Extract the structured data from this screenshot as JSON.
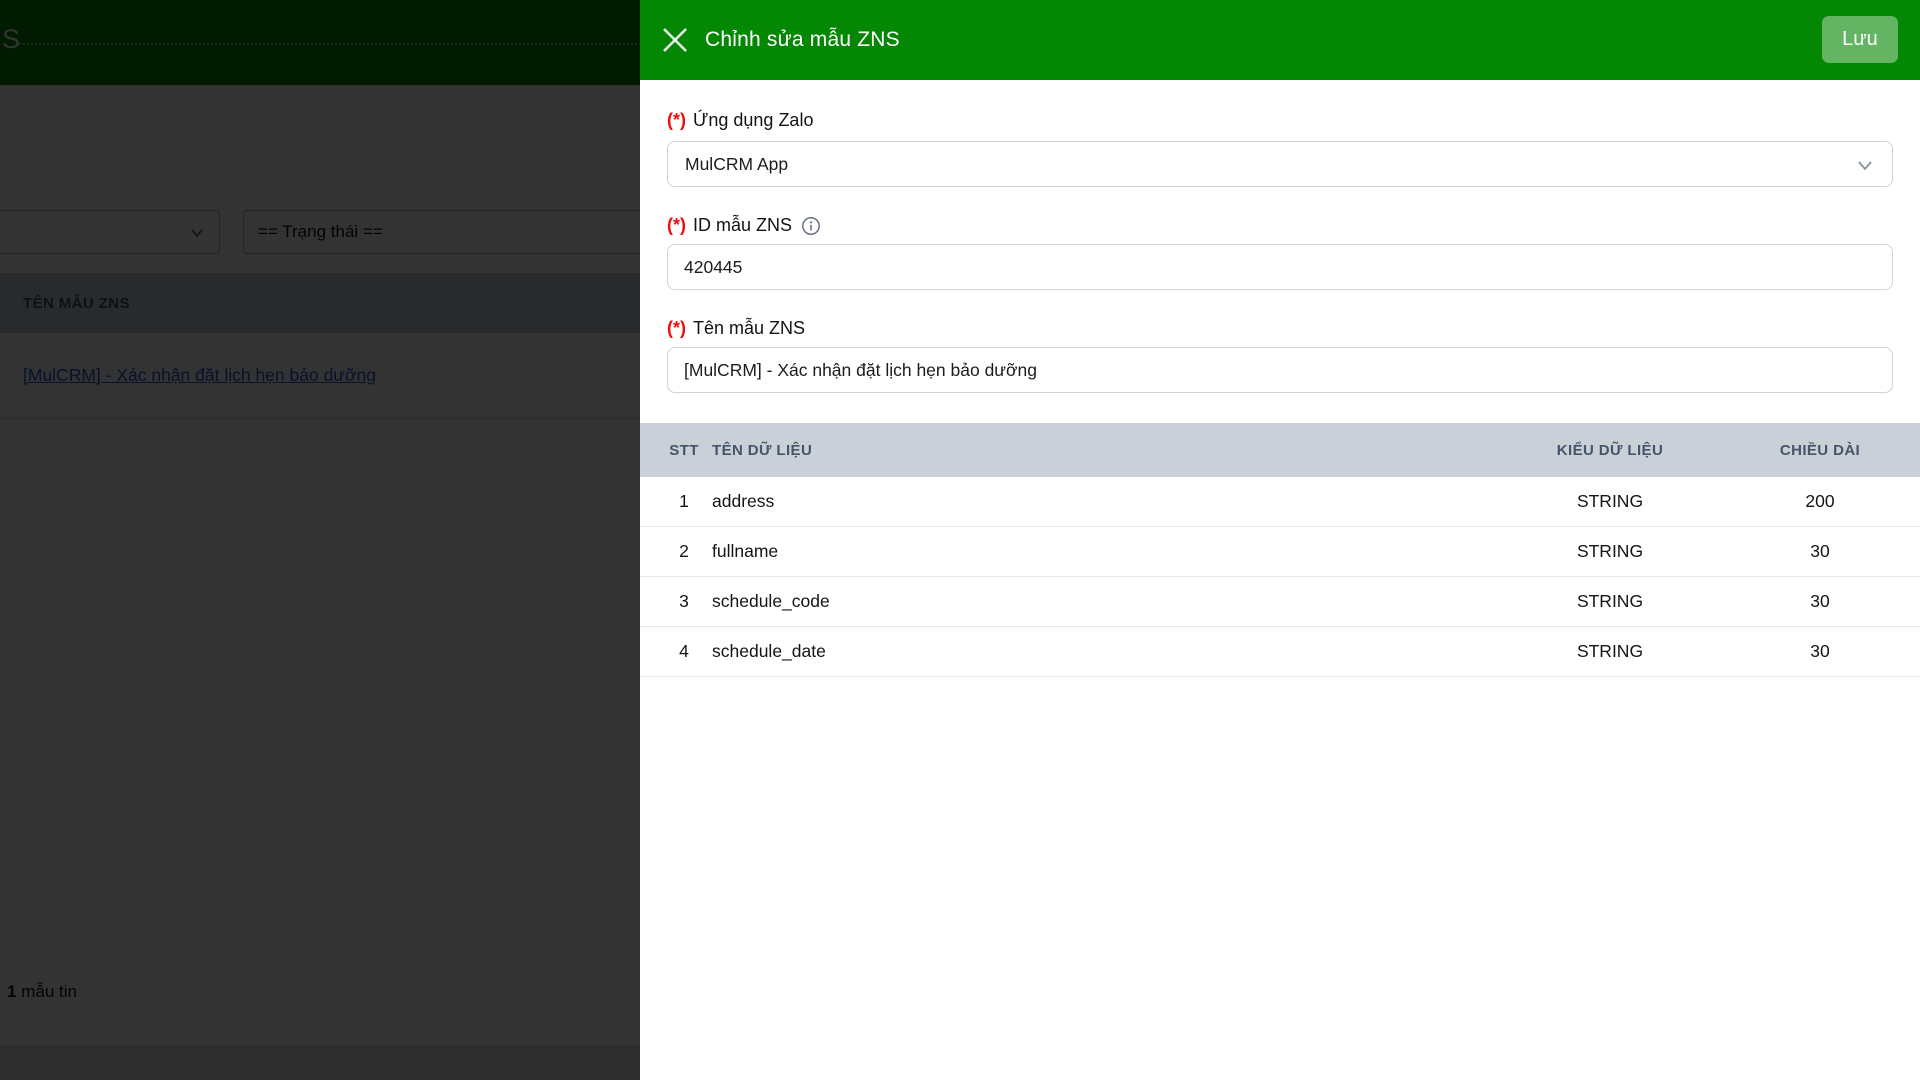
{
  "background": {
    "topbar_partial_text": "S",
    "filters": {
      "status_select_value": "== Trạng thái =="
    },
    "list_table": {
      "header_name": "TÊN MẪU ZNS",
      "row_link": "[MulCRM] - Xác nhận đặt lịch hẹn bảo dưỡng"
    },
    "record_count": {
      "value": "1",
      "label": "mẫu tin"
    }
  },
  "panel": {
    "title": "Chỉnh sửa mẫu ZNS",
    "save_label": "Lưu",
    "fields": {
      "zalo_app": {
        "required_mark": "(*)",
        "label": "Ứng dụng Zalo",
        "value": "MulCRM App"
      },
      "zns_id": {
        "required_mark": "(*)",
        "label": "ID mẫu ZNS",
        "value": "420445"
      },
      "zns_name": {
        "required_mark": "(*)",
        "label": "Tên mẫu ZNS",
        "value": "[MulCRM] - Xác nhận đặt lịch hẹn bảo dưỡng"
      }
    },
    "table": {
      "headers": {
        "stt": "STT",
        "name": "TÊN DỮ LIỆU",
        "type": "KIỂU DỮ LIỆU",
        "length": "CHIỀU DÀI"
      },
      "rows": [
        {
          "stt": "1",
          "name": "address",
          "type": "STRING",
          "length": "200"
        },
        {
          "stt": "2",
          "name": "fullname",
          "type": "STRING",
          "length": "30"
        },
        {
          "stt": "3",
          "name": "schedule_code",
          "type": "STRING",
          "length": "30"
        },
        {
          "stt": "4",
          "name": "schedule_date",
          "type": "STRING",
          "length": "30"
        }
      ]
    }
  },
  "colors": {
    "accent_green": "#048804",
    "save_button_bg": "rgba(255,255,255,0.38)",
    "required_red": "#f40b0b",
    "table_header_bg": "#c9d0d7",
    "table_header_text": "#44546a",
    "link_blue": "#2f55d4"
  }
}
